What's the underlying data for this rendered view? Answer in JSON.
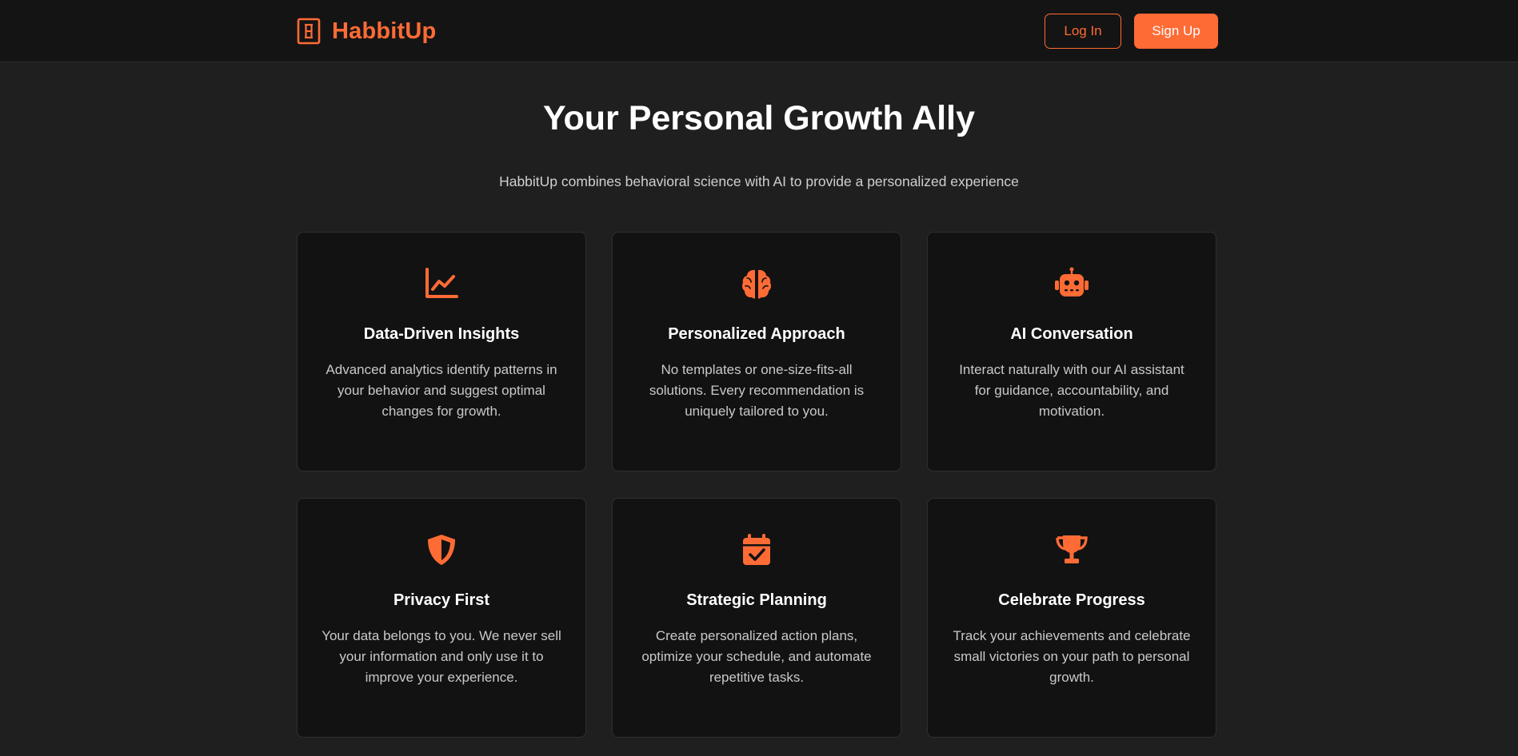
{
  "brand": {
    "name": "HabbitUp",
    "accent": "#ff6b35"
  },
  "nav": {
    "login_label": "Log In",
    "signup_label": "Sign Up"
  },
  "hero": {
    "title": "Your Personal Growth Ally",
    "subtitle": "HabbitUp combines behavioral science with AI to provide a personalized experience"
  },
  "features": [
    {
      "icon": "line-chart-icon",
      "title": "Data-Driven Insights",
      "description": "Advanced analytics identify patterns in your behavior and suggest optimal changes for growth."
    },
    {
      "icon": "brain-icon",
      "title": "Personalized Approach",
      "description": "No templates or one-size-fits-all solutions. Every recommendation is uniquely tailored to you."
    },
    {
      "icon": "robot-icon",
      "title": "AI Conversation",
      "description": "Interact naturally with our AI assistant for guidance, accountability, and motivation."
    },
    {
      "icon": "shield-icon",
      "title": "Privacy First",
      "description": "Your data belongs to you. We never sell your information and only use it to improve your experience."
    },
    {
      "icon": "calendar-check-icon",
      "title": "Strategic Planning",
      "description": "Create personalized action plans, optimize your schedule, and automate repetitive tasks."
    },
    {
      "icon": "trophy-icon",
      "title": "Celebrate Progress",
      "description": "Track your achievements and celebrate small victories on your path to personal growth."
    }
  ]
}
